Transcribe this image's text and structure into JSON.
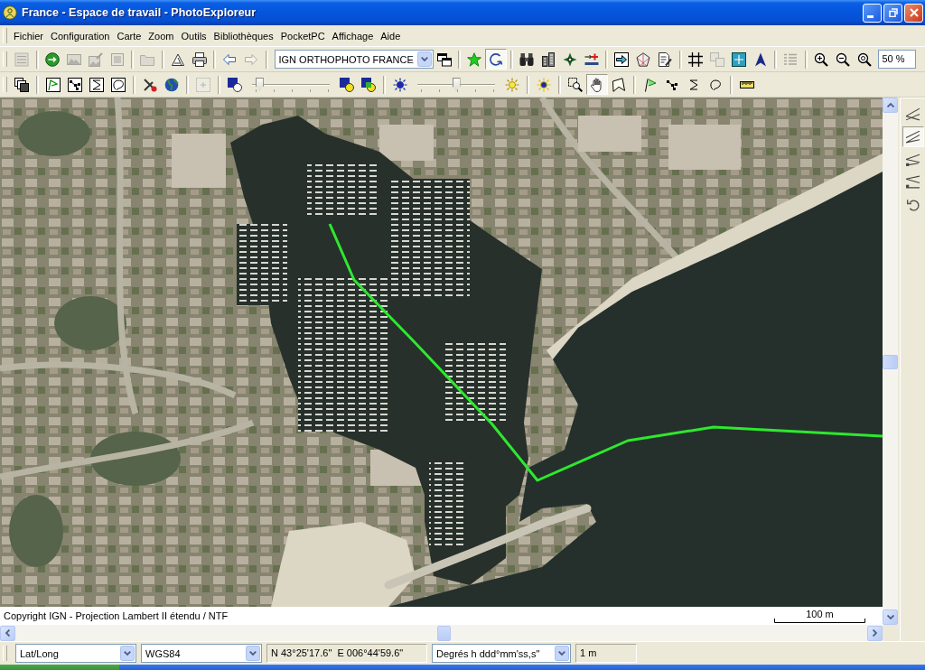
{
  "window": {
    "title": "France - Espace de travail - PhotoExploreur"
  },
  "menu": [
    "Fichier",
    "Configuration",
    "Carte",
    "Zoom",
    "Outils",
    "Bibliothèques",
    "PocketPC",
    "Affichage",
    "Aide"
  ],
  "toolbar_1": {
    "groups": [
      [
        {
          "kind": "button",
          "disabled": true,
          "pressed": false
        }
      ],
      [
        {
          "kind": "button",
          "disabled": false,
          "pressed": false
        },
        {
          "kind": "button",
          "disabled": true,
          "pressed": false
        },
        {
          "kind": "button",
          "disabled": true,
          "pressed": false
        },
        {
          "kind": "button",
          "disabled": true,
          "pressed": false
        }
      ],
      [
        {
          "kind": "button",
          "disabled": true,
          "pressed": false
        }
      ],
      [
        {
          "kind": "button",
          "disabled": false,
          "pressed": false
        },
        {
          "kind": "button",
          "disabled": false,
          "pressed": false
        }
      ],
      [
        {
          "kind": "button",
          "disabled": false,
          "pressed": false
        },
        {
          "kind": "button",
          "disabled": true,
          "pressed": false
        }
      ],
      [
        {
          "kind": "dropdown",
          "value": "IGN ORTHOPHOTO FRANCE"
        },
        {
          "kind": "button",
          "disabled": false,
          "pressed": false
        }
      ],
      [
        {
          "kind": "button",
          "disabled": false,
          "pressed": false
        },
        {
          "kind": "button",
          "disabled": false,
          "pressed": true
        }
      ],
      [
        {
          "kind": "button",
          "disabled": false,
          "pressed": false
        },
        {
          "kind": "button",
          "disabled": false,
          "pressed": false
        },
        {
          "kind": "button",
          "disabled": false,
          "pressed": false
        },
        {
          "kind": "button",
          "disabled": false,
          "pressed": false
        }
      ],
      [
        {
          "kind": "button",
          "disabled": false,
          "pressed": false
        },
        {
          "kind": "button",
          "disabled": false,
          "pressed": false
        },
        {
          "kind": "button",
          "disabled": false,
          "pressed": false
        }
      ],
      [
        {
          "kind": "button",
          "disabled": false,
          "pressed": false
        },
        {
          "kind": "button",
          "disabled": true,
          "pressed": false
        },
        {
          "kind": "button",
          "disabled": false,
          "pressed": false
        },
        {
          "kind": "button",
          "disabled": false,
          "pressed": false
        }
      ],
      [
        {
          "kind": "button",
          "disabled": true,
          "pressed": false
        }
      ],
      [
        {
          "kind": "button",
          "disabled": false,
          "pressed": false
        },
        {
          "kind": "button",
          "disabled": false,
          "pressed": false
        },
        {
          "kind": "button",
          "disabled": false,
          "pressed": false
        },
        {
          "kind": "field",
          "value": "50 %"
        }
      ]
    ]
  },
  "toolbar_2": {
    "groups": [
      [
        {
          "kind": "button",
          "disabled": false,
          "pressed": false
        }
      ],
      [
        {
          "kind": "button",
          "disabled": false,
          "pressed": false
        },
        {
          "kind": "button",
          "disabled": false,
          "pressed": false
        },
        {
          "kind": "button",
          "disabled": false,
          "pressed": false
        },
        {
          "kind": "button",
          "disabled": false,
          "pressed": false
        }
      ],
      [
        {
          "kind": "button",
          "disabled": false,
          "pressed": false
        },
        {
          "kind": "button",
          "disabled": false,
          "pressed": false
        }
      ],
      [
        {
          "kind": "button",
          "disabled": true,
          "pressed": false
        }
      ],
      [
        {
          "kind": "button",
          "disabled": false,
          "pressed": false
        },
        {
          "kind": "slider",
          "level": 0.05
        },
        {
          "kind": "button",
          "disabled": false,
          "pressed": false
        },
        {
          "kind": "button",
          "disabled": false,
          "pressed": false
        }
      ],
      [
        {
          "kind": "button",
          "disabled": false,
          "pressed": false
        },
        {
          "kind": "slider",
          "level": 0.5
        },
        {
          "kind": "button",
          "disabled": false,
          "pressed": false
        }
      ],
      [
        {
          "kind": "button",
          "disabled": false,
          "pressed": false
        }
      ],
      [
        {
          "kind": "button",
          "disabled": false,
          "pressed": false
        },
        {
          "kind": "button",
          "disabled": false,
          "pressed": true
        },
        {
          "kind": "button",
          "disabled": false,
          "pressed": false
        }
      ],
      [
        {
          "kind": "button",
          "disabled": false,
          "pressed": false
        },
        {
          "kind": "button",
          "disabled": false,
          "pressed": false
        },
        {
          "kind": "button",
          "disabled": false,
          "pressed": false
        },
        {
          "kind": "button",
          "disabled": false,
          "pressed": false
        }
      ],
      [
        {
          "kind": "button",
          "disabled": false,
          "pressed": false
        }
      ]
    ]
  },
  "side_tools": [
    {
      "pressed": false
    },
    {
      "pressed": true
    },
    {
      "pressed": false
    },
    {
      "pressed": false
    },
    {
      "pressed": false
    }
  ],
  "map": {
    "copyright": "Copyright IGN - Projection Lambert II étendu / NTF",
    "scale": "100 m"
  },
  "status_bar": [
    {
      "kind": "dropdown",
      "value": "Lat/Long"
    },
    {
      "kind": "dropdown",
      "value": "WGS84"
    },
    {
      "kind": "readout",
      "value": "N 43°25'17.6\"  E 006°44'59.6\""
    },
    {
      "kind": "dropdown",
      "value": "Degrés h ddd°mm'ss,s\""
    },
    {
      "kind": "readout",
      "value": "1 m"
    }
  ]
}
